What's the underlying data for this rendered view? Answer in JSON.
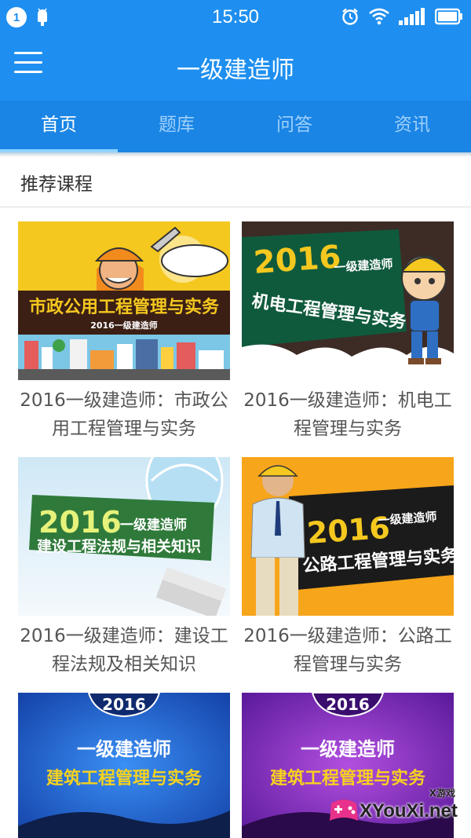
{
  "status_bar": {
    "notification_count": "1",
    "time": "15:50",
    "icons": [
      "android-icon",
      "alarm-icon",
      "wifi-icon",
      "signal-icon",
      "battery-icon"
    ]
  },
  "app_bar": {
    "title": "一级建造师",
    "menu_icon": "menu-icon"
  },
  "tabs": [
    {
      "label": "首页",
      "active": true
    },
    {
      "label": "题库",
      "active": false
    },
    {
      "label": "问答",
      "active": false
    },
    {
      "label": "资讯",
      "active": false
    }
  ],
  "section": {
    "title": "推荐课程"
  },
  "courses": [
    {
      "title": "2016一级建造师：市政公用工程管理与实务",
      "thumb_banner": "市政公用工程管理与实务",
      "thumb_sub": "2016一级建造师"
    },
    {
      "title": "2016一级建造师：机电工程管理与实务",
      "thumb_year": "2016",
      "thumb_tag": "一级建造师",
      "thumb_banner": "机电工程管理与实务"
    },
    {
      "title": "2016一级建造师：建设工程法规及相关知识",
      "thumb_year": "2016",
      "thumb_tag": "一级建造师",
      "thumb_banner": "建设工程法规与相关知识"
    },
    {
      "title": "2016一级建造师：公路工程管理与实务",
      "thumb_year": "2016",
      "thumb_tag": "一级建造师",
      "thumb_banner": "公路工程管理与实务"
    },
    {
      "title": "",
      "thumb_year": "2016",
      "thumb_tag": "一级建造师",
      "thumb_banner": "建筑工程管理与实务"
    },
    {
      "title": "",
      "thumb_year": "2016",
      "thumb_tag": "一级建造师",
      "thumb_banner": "建筑工程管理与实务"
    }
  ],
  "watermark": {
    "text": "XYouXi.net",
    "small": "X游戏"
  },
  "colors": {
    "primary": "#1e8ff0",
    "tab_bar": "#1a85e5",
    "tab_inactive": "#9fd0fb",
    "tab_indicator": "#8fd3ff"
  }
}
